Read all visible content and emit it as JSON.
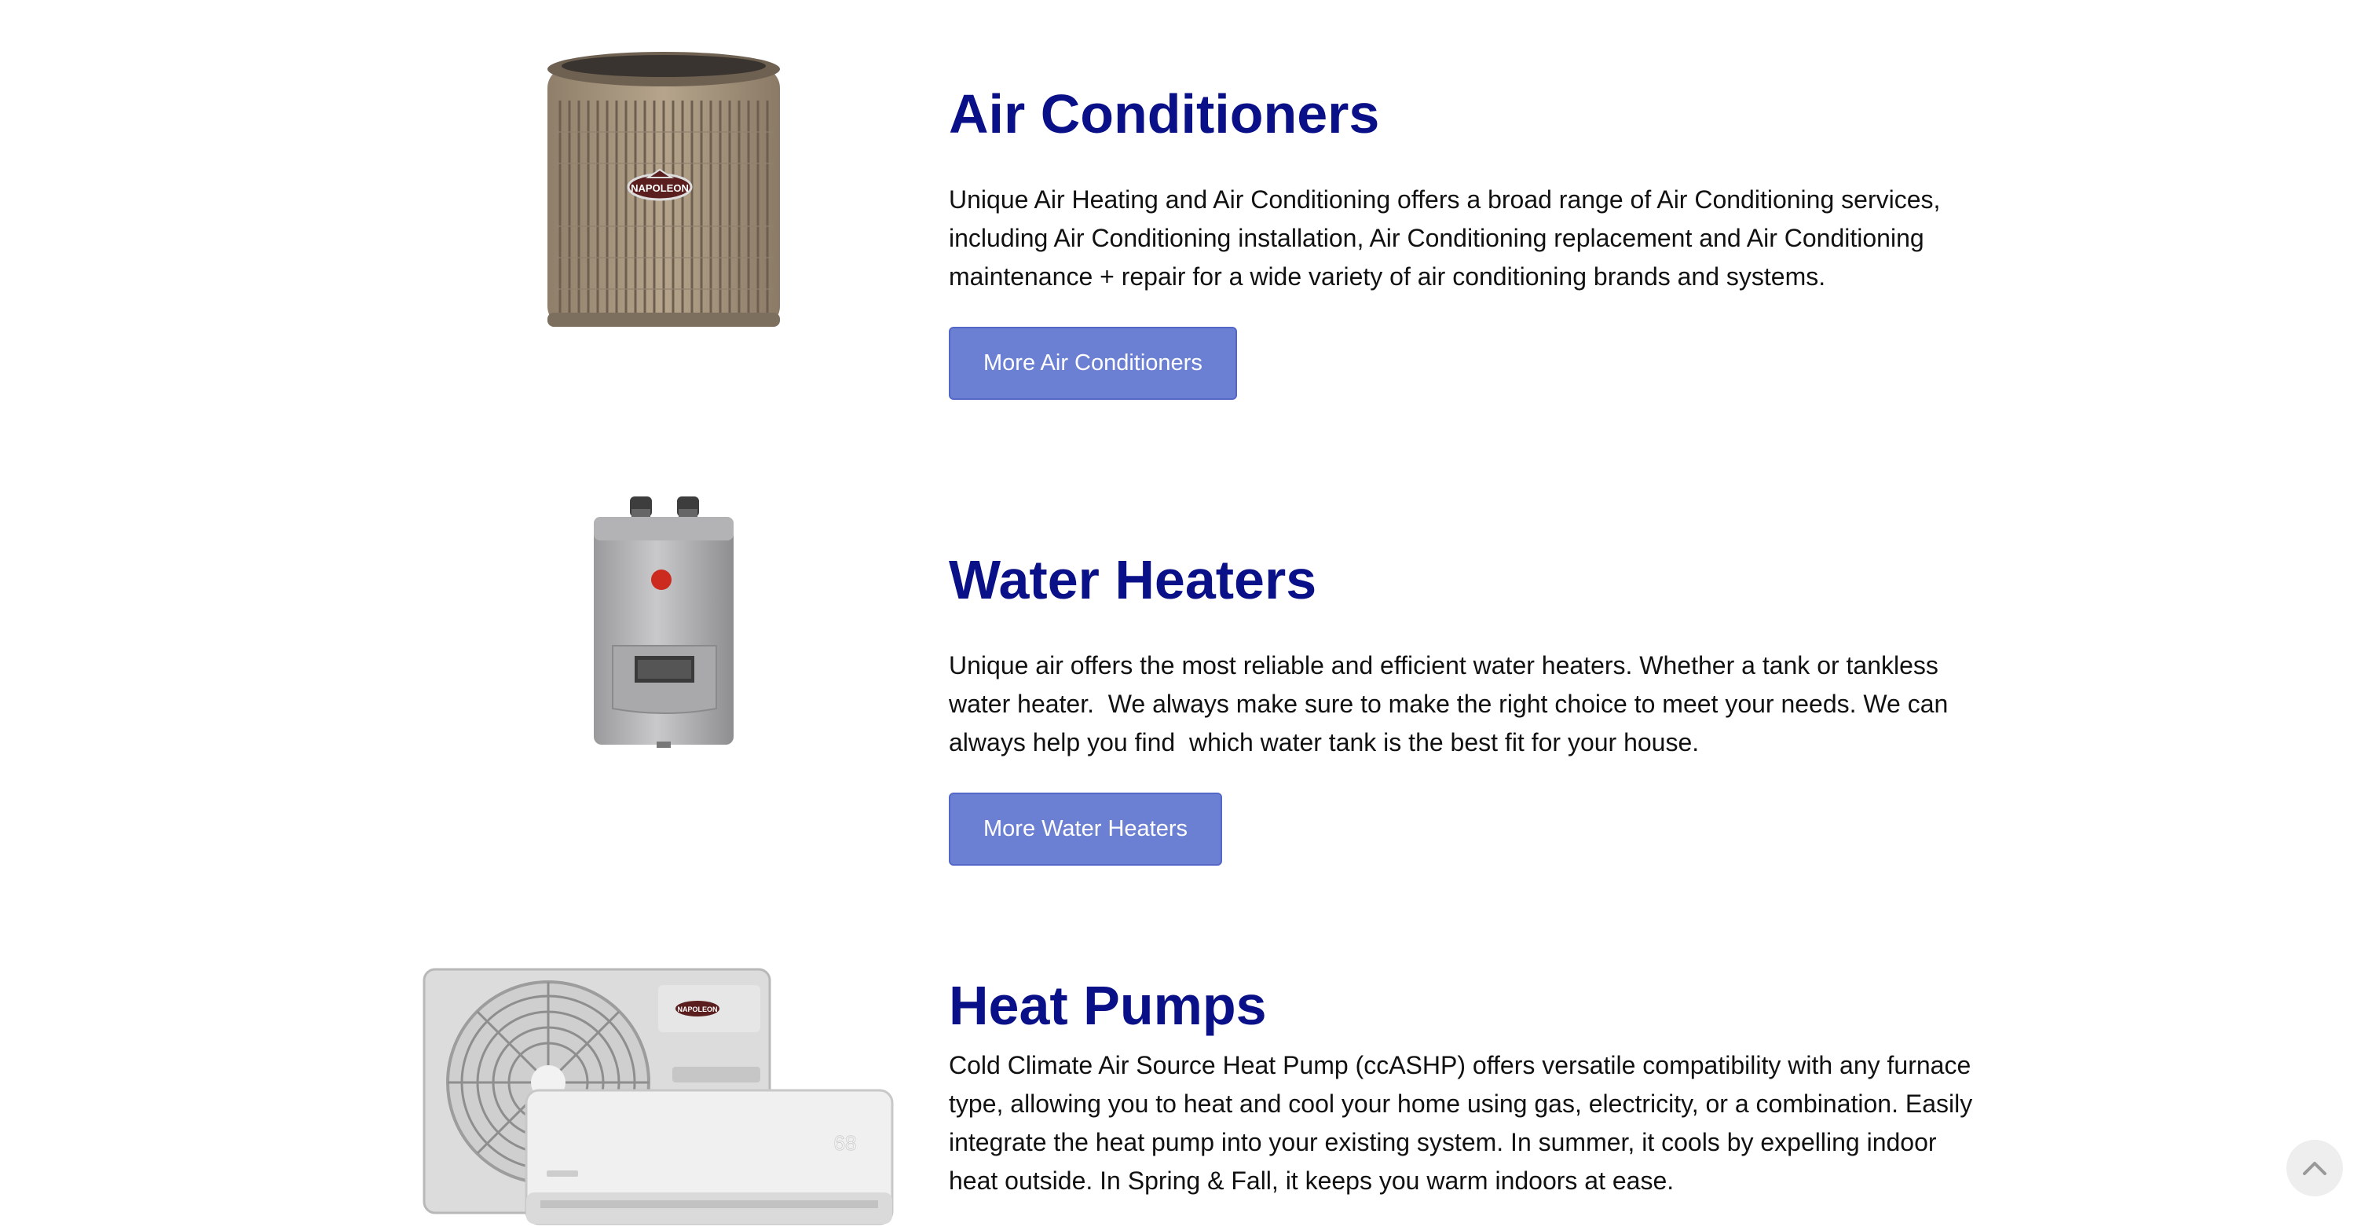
{
  "sections": [
    {
      "title": "Air Conditioners",
      "description": "Unique Air Heating and Air Conditioning offers a broad range of Air Conditioning services, including Air Conditioning installation, Air Conditioning replacement and Air Conditioning maintenance + repair for a wide variety of air conditioning brands and systems.",
      "button_label": "More Air Conditioners",
      "image_icon": "air-conditioner-unit",
      "brand_badge": "NAPOLEON"
    },
    {
      "title": "Water Heaters",
      "description": "Unique air offers the most reliable and efficient water heaters. Whether a tank or tankless water heater.  We always make sure to make the right choice to meet your needs. We can always help you find  which water tank is the best fit for your house.",
      "button_label": "More Water Heaters",
      "image_icon": "tankless-water-heater"
    },
    {
      "title": "Heat Pumps",
      "description": "Cold Climate Air Source Heat Pump (ccASHP) offers versatile compatibility with any furnace type, allowing you to heat and cool your home using gas, electricity, or a combination. Easily integrate the heat pump into your existing system. In summer, it cools by expelling indoor heat outside. In Spring & Fall, it keeps you warm indoors at ease.",
      "image_icon": "mini-split-heat-pump",
      "brand_badge": "NAPOLEON",
      "display_readout": "68"
    }
  ],
  "scroll_top_icon": "chevron-up-icon",
  "colors": {
    "heading": "#0a1087",
    "button_bg": "#6c80d3",
    "button_text": "#ffffff"
  }
}
